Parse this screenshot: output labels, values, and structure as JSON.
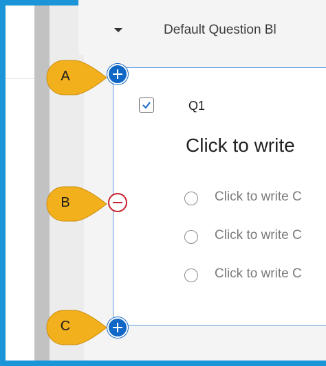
{
  "block": {
    "title": "Default Question Bl"
  },
  "question": {
    "number": "Q1",
    "text": "Click to write",
    "choices": [
      "Click to write C",
      "Click to write C",
      "Click to write C"
    ]
  },
  "callouts": {
    "a": "A",
    "b": "B",
    "c": "C"
  },
  "colors": {
    "frame": "#1b95d8",
    "callout": "#f3b01d",
    "add_button": "#1167c6",
    "remove_button": "#c8202a",
    "card_border": "#5b9be6"
  },
  "icons": {
    "collapse": "caret-down-icon",
    "checkbox": "checkbox-checked-icon",
    "add": "plus-circle-icon",
    "remove": "minus-circle-icon",
    "radio": "radio-unselected-icon"
  }
}
